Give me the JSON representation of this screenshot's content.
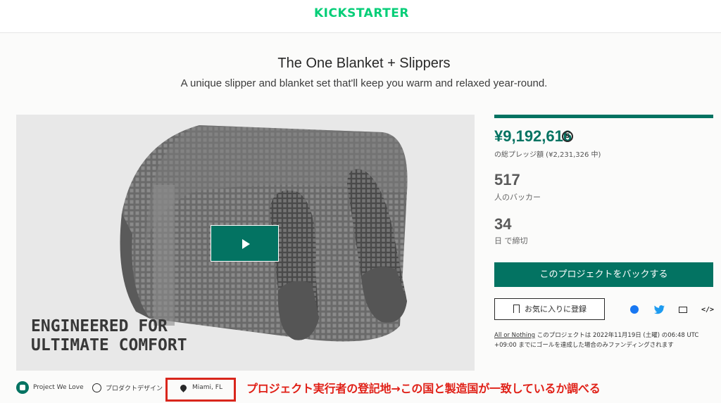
{
  "header": {
    "logo_text": "KICKSTARTER"
  },
  "project": {
    "title": "The One Blanket + Slippers",
    "subtitle": "A unique slipper and blanket set that'll keep you warm and relaxed year-round.",
    "media_overlay_line1": "ENGINEERED FOR",
    "media_overlay_line2": "ULTIMATE COMFORT"
  },
  "stats": {
    "funding_progress_percent": 100,
    "pledged_amount": "¥9,192,616",
    "pledged_label": "の総プレッジ額 (¥2,231,326 中)",
    "backers_count": "517",
    "backers_label": "人のバッカー",
    "days_left": "34",
    "days_label": "日 で締切"
  },
  "actions": {
    "back_button": "このプロジェクトをバックする",
    "remind_button": "お気に入りに登録",
    "embed_symbol": "</>"
  },
  "fineprint": {
    "link": "All or Nothing",
    "text": " このプロジェクトは 2022年11月19日 (土曜) の06:48 UTC +09:00 までにゴールを達成した場合のみファンディングされます"
  },
  "meta": {
    "badge": "Project We Love",
    "category": "プロダクトデザイン",
    "location": "Miami, FL"
  },
  "annotation": {
    "text": "プロジェクト実行者の登記地→この国と製造国が一致しているか調べる",
    "color": "#e02017"
  },
  "colors": {
    "brand": "#05ce78",
    "accent": "#037362"
  }
}
